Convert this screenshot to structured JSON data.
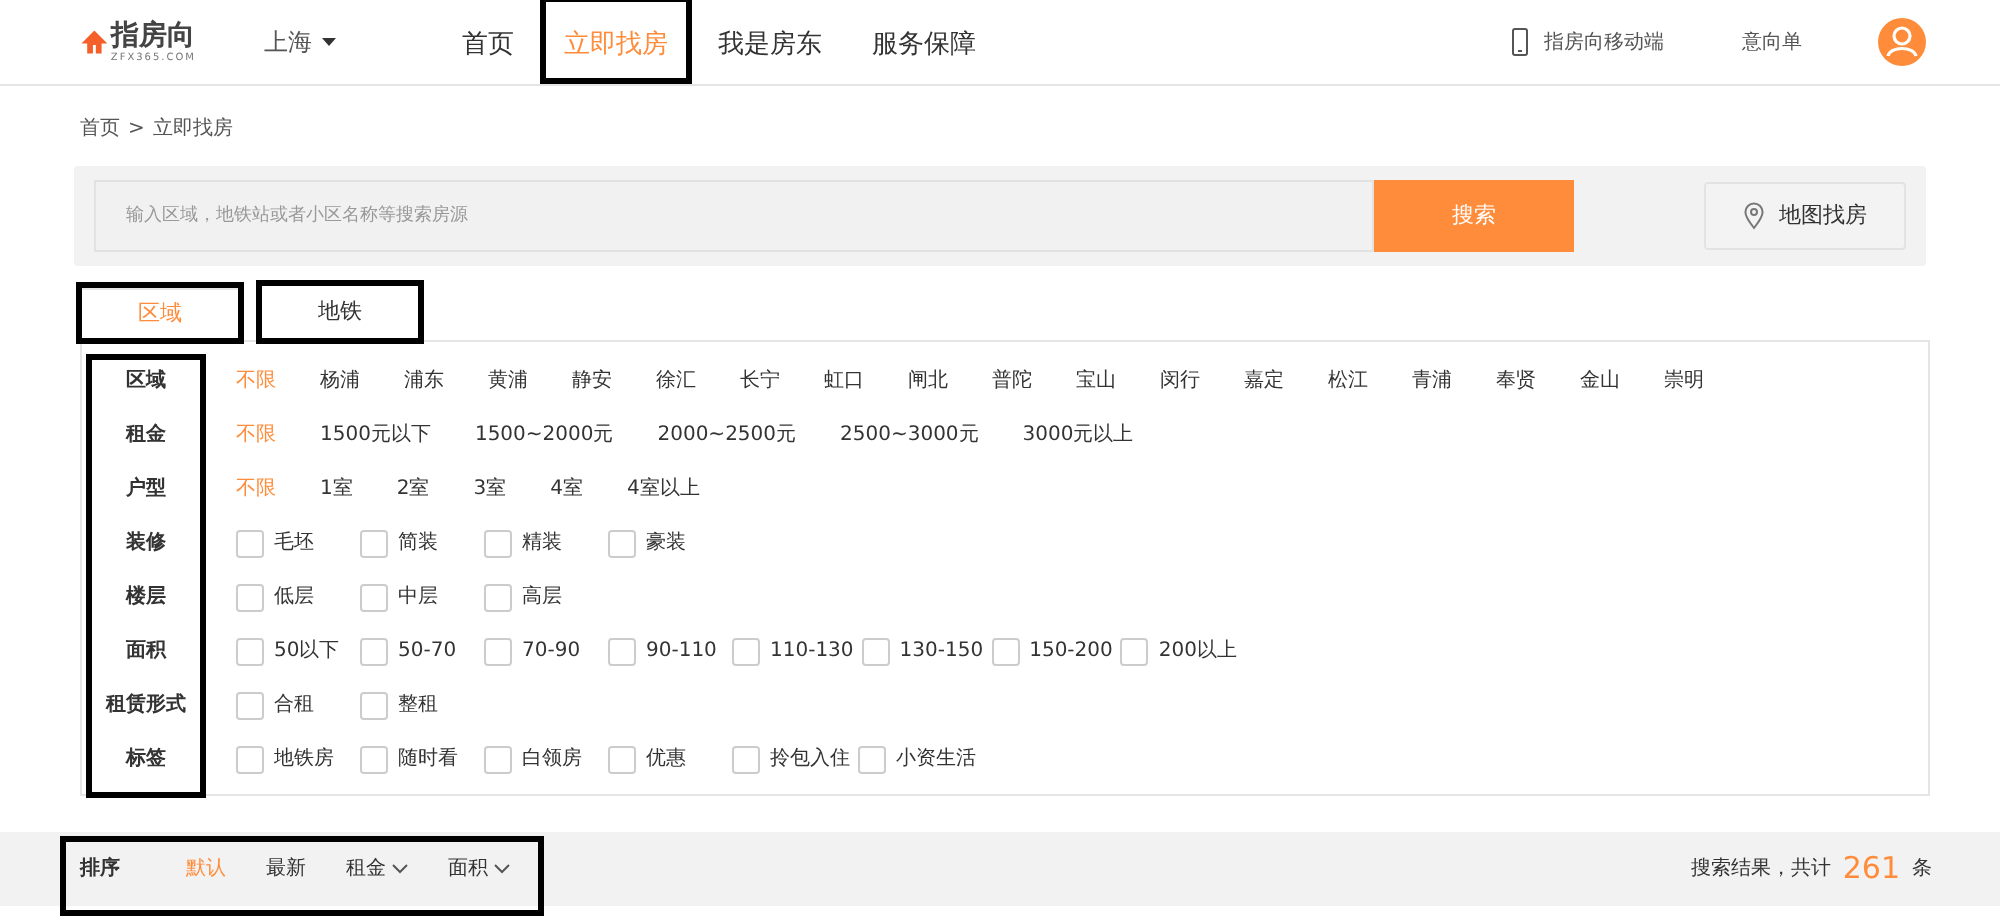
{
  "header": {
    "logo": {
      "name": "指房向",
      "tagline": "ZFX365.COM"
    },
    "city": "上海",
    "nav": [
      {
        "label": "首页",
        "selected": false,
        "highlighted": false
      },
      {
        "label": "立即找房",
        "selected": true,
        "highlighted": true
      },
      {
        "label": "我是房东",
        "selected": false,
        "highlighted": false
      },
      {
        "label": "服务保障",
        "selected": false,
        "highlighted": false
      }
    ],
    "mobile_link": "指房向移动端",
    "wishlist": "意向单"
  },
  "breadcrumb": [
    "首页",
    ">",
    "立即找房"
  ],
  "search": {
    "placeholder": "输入区域，地铁站或者小区名称等搜索房源",
    "button": "搜索",
    "map_button": "地图找房"
  },
  "tabs": [
    {
      "label": "区域",
      "selected": true,
      "highlighted": true
    },
    {
      "label": "地铁",
      "selected": false,
      "highlighted": true
    }
  ],
  "filters_highlighted": true,
  "filters": [
    {
      "label": "区域",
      "kind": "links",
      "options": [
        {
          "label": "不限",
          "selected": true
        },
        {
          "label": "杨浦",
          "selected": false
        },
        {
          "label": "浦东",
          "selected": false
        },
        {
          "label": "黄浦",
          "selected": false
        },
        {
          "label": "静安",
          "selected": false
        },
        {
          "label": "徐汇",
          "selected": false
        },
        {
          "label": "长宁",
          "selected": false
        },
        {
          "label": "虹口",
          "selected": false
        },
        {
          "label": "闸北",
          "selected": false
        },
        {
          "label": "普陀",
          "selected": false
        },
        {
          "label": "宝山",
          "selected": false
        },
        {
          "label": "闵行",
          "selected": false
        },
        {
          "label": "嘉定",
          "selected": false
        },
        {
          "label": "松江",
          "selected": false
        },
        {
          "label": "青浦",
          "selected": false
        },
        {
          "label": "奉贤",
          "selected": false
        },
        {
          "label": "金山",
          "selected": false
        },
        {
          "label": "崇明",
          "selected": false
        }
      ]
    },
    {
      "label": "租金",
      "kind": "links",
      "options": [
        {
          "label": "不限",
          "selected": true
        },
        {
          "label": "1500元以下",
          "selected": false
        },
        {
          "label": "1500~2000元",
          "selected": false
        },
        {
          "label": "2000~2500元",
          "selected": false
        },
        {
          "label": "2500~3000元",
          "selected": false
        },
        {
          "label": "3000元以上",
          "selected": false
        }
      ]
    },
    {
      "label": "户型",
      "kind": "links",
      "options": [
        {
          "label": "不限",
          "selected": true
        },
        {
          "label": "1室",
          "selected": false
        },
        {
          "label": "2室",
          "selected": false
        },
        {
          "label": "3室",
          "selected": false
        },
        {
          "label": "4室",
          "selected": false
        },
        {
          "label": "4室以上",
          "selected": false
        }
      ]
    },
    {
      "label": "装修",
      "kind": "checkboxes",
      "options": [
        {
          "label": "毛坯",
          "checked": false
        },
        {
          "label": "简装",
          "checked": false
        },
        {
          "label": "精装",
          "checked": false
        },
        {
          "label": "豪装",
          "checked": false
        }
      ]
    },
    {
      "label": "楼层",
      "kind": "checkboxes",
      "options": [
        {
          "label": "低层",
          "checked": false
        },
        {
          "label": "中层",
          "checked": false
        },
        {
          "label": "高层",
          "checked": false
        }
      ]
    },
    {
      "label": "面积",
      "kind": "checkboxes",
      "options": [
        {
          "label": "50以下",
          "checked": false
        },
        {
          "label": "50-70",
          "checked": false
        },
        {
          "label": "70-90",
          "checked": false
        },
        {
          "label": "90-110",
          "checked": false
        },
        {
          "label": "110-130",
          "checked": false
        },
        {
          "label": "130-150",
          "checked": false
        },
        {
          "label": "150-200",
          "checked": false
        },
        {
          "label": "200以上",
          "checked": false
        }
      ]
    },
    {
      "label": "租赁形式",
      "kind": "checkboxes",
      "options": [
        {
          "label": "合租",
          "checked": false
        },
        {
          "label": "整租",
          "checked": false
        }
      ]
    },
    {
      "label": "标签",
      "kind": "checkboxes",
      "options": [
        {
          "label": "地铁房",
          "checked": false
        },
        {
          "label": "随时看",
          "checked": false
        },
        {
          "label": "白领房",
          "checked": false
        },
        {
          "label": "优惠",
          "checked": false
        },
        {
          "label": "拎包入住",
          "checked": false
        },
        {
          "label": "小资生活",
          "checked": false
        }
      ]
    }
  ],
  "sort_bar": {
    "highlighted": true,
    "label": "排序",
    "options": [
      {
        "label": "默认",
        "selected": true,
        "dropdown": false
      },
      {
        "label": "最新",
        "selected": false,
        "dropdown": false
      },
      {
        "label": "租金",
        "selected": false,
        "dropdown": true
      },
      {
        "label": "面积",
        "selected": false,
        "dropdown": true
      }
    ],
    "result_prefix": "搜索结果，共计",
    "result_count": "261",
    "result_suffix": "条"
  }
}
